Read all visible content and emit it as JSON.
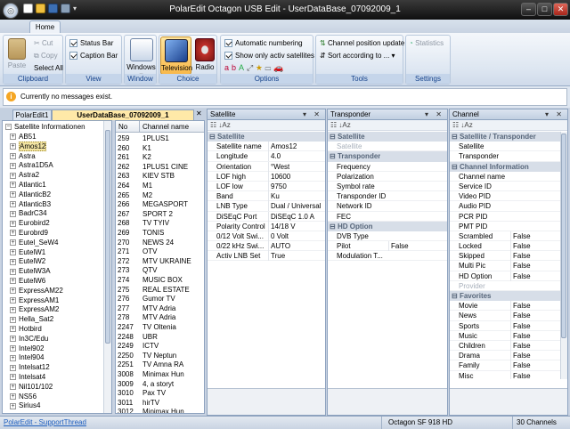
{
  "window": {
    "title": "PolarEdit Octagon USB Edit - UserDataBase_07092009_1",
    "min": "–",
    "max": "□",
    "close": "✕"
  },
  "ribbon": {
    "tab": "Home",
    "clipboard": {
      "paste": "Paste",
      "cut": "Cut",
      "copy": "Copy",
      "select_all": "Select All",
      "label": "Clipboard"
    },
    "view": {
      "status_bar": "Status Bar",
      "caption_bar": "Caption Bar",
      "label": "View"
    },
    "window": {
      "windows": "Windows",
      "label": "Window"
    },
    "choice": {
      "television": "Television",
      "radio": "Radio",
      "label": "Choice"
    },
    "options": {
      "auto_numbering": "Automatic numbering",
      "show_only": "Show only activ satellites",
      "label": "Options"
    },
    "tools": {
      "channel_position_update": "Channel position update",
      "sort_according": "Sort according to ...",
      "label": "Tools"
    },
    "settings": {
      "statistics": "Statistics",
      "label": "Settings"
    }
  },
  "message": "Currently no messages exist.",
  "doc_tabs": [
    "PolarEdit1",
    "UserDataBase_07092009_1"
  ],
  "tree": {
    "root": "Satellite Informationen",
    "items": [
      "AB51",
      "Amos12",
      "Astra",
      "Astra1D5A",
      "Astra2",
      "Atlantic1",
      "AtlanticB2",
      "AtlanticB3",
      "BadrC34",
      "Eurobird2",
      "Eurobrd9",
      "Eutel_SeW4",
      "EutelW1",
      "EutelW2",
      "EutelW3A",
      "EutelW6",
      "ExpressAM22",
      "ExpressAM1",
      "ExpressAM2",
      "Hella_Sat2",
      "Hotbird",
      "In3C/Edu",
      "Intel902",
      "Intel904",
      "Intelsat12",
      "Intelsat4",
      "Nil101/102",
      "NS56",
      "Sirius4"
    ],
    "selected": "Amos12"
  },
  "channels": {
    "headers": [
      "No",
      "Channel name"
    ],
    "rows": [
      [
        "259",
        "1PLUS1"
      ],
      [
        "260",
        "K1"
      ],
      [
        "261",
        "K2"
      ],
      [
        "262",
        "1PLUS1 CINE"
      ],
      [
        "263",
        "KIEV STB"
      ],
      [
        "264",
        "M1"
      ],
      [
        "265",
        "M2"
      ],
      [
        "266",
        "MEGASPORT"
      ],
      [
        "267",
        "SPORT 2"
      ],
      [
        "268",
        "TV TYIV"
      ],
      [
        "269",
        "TONIS"
      ],
      [
        "270",
        "NEWS 24"
      ],
      [
        "271",
        "OTV"
      ],
      [
        "272",
        "MTV UKRAINE"
      ],
      [
        "273",
        "QTV"
      ],
      [
        "274",
        "MUSIC BOX"
      ],
      [
        "275",
        "REAL ESTATE"
      ],
      [
        "276",
        "Gumor TV"
      ],
      [
        "277",
        "MTV Adria"
      ],
      [
        "278",
        "MTV Adria"
      ],
      [
        "2247",
        "TV Oltenia"
      ],
      [
        "2248",
        "UBR"
      ],
      [
        "2249",
        "ICTV"
      ],
      [
        "2250",
        "TV Neptun"
      ],
      [
        "2251",
        "TV Amna RA"
      ],
      [
        "3008",
        "Minimax Hun"
      ],
      [
        "3009",
        "4, a storyt"
      ],
      [
        "3010",
        "Pax TV"
      ],
      [
        "3011",
        "hirTV"
      ],
      [
        "3012",
        "Minimax Hun"
      ]
    ]
  },
  "satellite_panel": {
    "title": "Satellite",
    "rows": [
      {
        "cat": "Satellite"
      },
      {
        "k": "Satellite name",
        "v": "Amos12"
      },
      {
        "k": "Longitude",
        "v": "4.0"
      },
      {
        "k": "Orientation",
        "v": "°West"
      },
      {
        "k": "LOF high",
        "v": "10600"
      },
      {
        "k": "LOF low",
        "v": "9750"
      },
      {
        "k": "Band",
        "v": "Ku"
      },
      {
        "k": "LNB Type",
        "v": "Dual / Universal"
      },
      {
        "k": "DiSEqC Port",
        "v": "DiSEqC 1.0 A"
      },
      {
        "k": "Polarity Control",
        "v": "14/18 V"
      },
      {
        "k": "0/12 Volt Swi...",
        "v": "0 Volt"
      },
      {
        "k": "0/22 kHz Swi...",
        "v": "AUTO"
      },
      {
        "k": "Activ LNB Set",
        "v": "True"
      }
    ]
  },
  "transponder_panel": {
    "title": "Transponder",
    "rows": [
      {
        "cat": "Satellite"
      },
      {
        "k": "Satellite",
        "v": "",
        "dim": true
      },
      {
        "cat": "Transponder"
      },
      {
        "k": "Frequency",
        "v": ""
      },
      {
        "k": "Polarization",
        "v": ""
      },
      {
        "k": "Symbol rate",
        "v": ""
      },
      {
        "k": "Transponder ID",
        "v": ""
      },
      {
        "k": "Network ID",
        "v": ""
      },
      {
        "k": "FEC",
        "v": ""
      },
      {
        "cat": "HD Option"
      },
      {
        "k": "DVB Type",
        "v": ""
      },
      {
        "k": "Pilot",
        "v": "False"
      },
      {
        "k": "Modulation T...",
        "v": ""
      }
    ]
  },
  "channel_panel": {
    "title": "Channel",
    "rows": [
      {
        "cat": "Satellite / Transponder"
      },
      {
        "k": "Satellite",
        "v": ""
      },
      {
        "k": "Transponder",
        "v": ""
      },
      {
        "cat": "Channel Information"
      },
      {
        "k": "Channel name",
        "v": ""
      },
      {
        "k": "Service ID",
        "v": ""
      },
      {
        "k": "Video PID",
        "v": ""
      },
      {
        "k": "Audio PID",
        "v": ""
      },
      {
        "k": "PCR PID",
        "v": ""
      },
      {
        "k": "PMT PID",
        "v": ""
      },
      {
        "k": "Scrambled",
        "v": "False"
      },
      {
        "k": "Locked",
        "v": "False"
      },
      {
        "k": "Skipped",
        "v": "False"
      },
      {
        "k": "Multi Pic",
        "v": "False"
      },
      {
        "k": "HD Option",
        "v": "False"
      },
      {
        "k": "Provider",
        "v": "",
        "dim": true
      },
      {
        "cat": "Favorites"
      },
      {
        "k": "Movie",
        "v": "False"
      },
      {
        "k": "News",
        "v": "False"
      },
      {
        "k": "Sports",
        "v": "False"
      },
      {
        "k": "Music",
        "v": "False"
      },
      {
        "k": "Children",
        "v": "False"
      },
      {
        "k": "Drama",
        "v": "False"
      },
      {
        "k": "Family",
        "v": "False"
      },
      {
        "k": "Misc",
        "v": "False"
      }
    ]
  },
  "status": {
    "left": "PolarEdit - SupportThread",
    "device": "Octagon SF 918 HD",
    "count": "30 Channels"
  }
}
